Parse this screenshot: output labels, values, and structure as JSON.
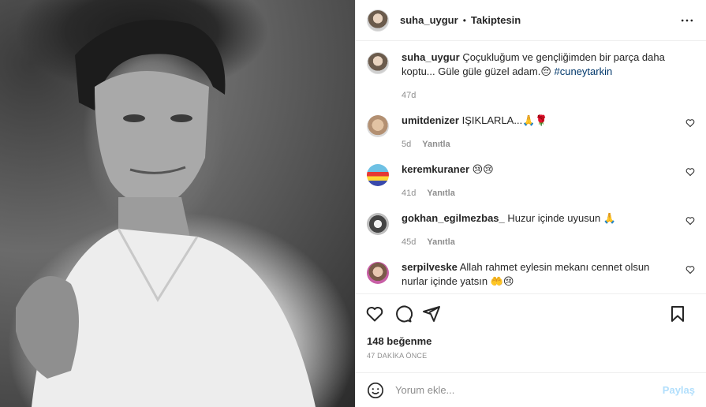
{
  "post": {
    "author": "suha_uygur",
    "separator": "•",
    "follow_status": "Takiptesin"
  },
  "caption": {
    "user": "suha_uygur",
    "text": "Çoçukluğum ve gençliğimden bir parça daha koptu... Güle güle güzel adam.😔 ",
    "hashtag": "#cuneytarkin",
    "time": "47d"
  },
  "comments": [
    {
      "user": "umitdenizer",
      "text": "IŞIKLARLA...🙏🌹",
      "time": "5d",
      "reply_label": "Yanıtla"
    },
    {
      "user": "keremkuraner",
      "text": "😢😢",
      "time": "41d",
      "reply_label": "Yanıtla"
    },
    {
      "user": "gokhan_egilmezbas_",
      "text": "Huzur içinde uyusun 🙏",
      "time": "45d",
      "reply_label": "Yanıtla"
    },
    {
      "user": "serpilveske",
      "text": "Allah rahmet eylesin mekanı cennet olsun nurlar içinde yatsın 🤲😢",
      "time": "",
      "reply_label": ""
    }
  ],
  "likes": "148 beğenme",
  "posted_ago": "47 DAKİKA ÖNCE",
  "comment_input": {
    "placeholder": "Yorum ekle...",
    "share_label": "Paylaş"
  },
  "icons": [
    "more-icon",
    "heart-icon",
    "comment-icon",
    "share-icon",
    "save-icon",
    "emoji-icon"
  ],
  "colors": {
    "link": "#00376b",
    "share_disabled": "#b2dffc",
    "muted": "#8e8e8e"
  }
}
